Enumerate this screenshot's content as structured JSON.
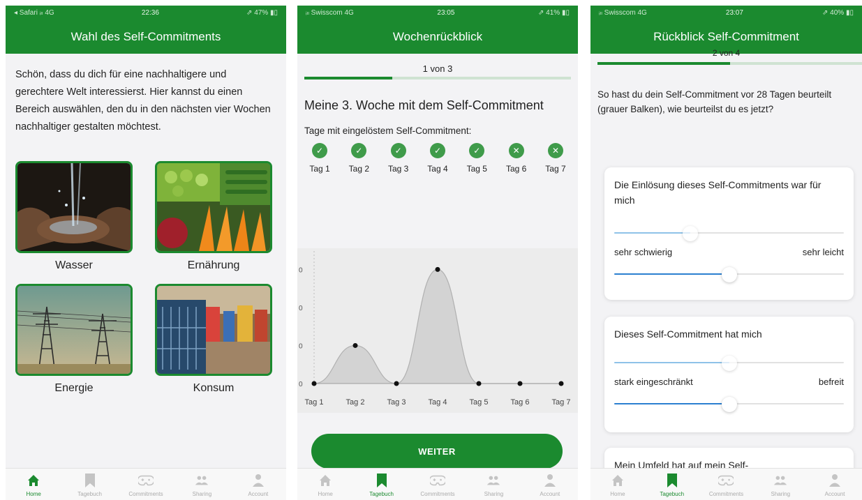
{
  "tabbar": {
    "items": [
      {
        "label": "Home",
        "icon": "home-icon"
      },
      {
        "label": "Tagebuch",
        "icon": "bookmark-icon"
      },
      {
        "label": "Commitments",
        "icon": "gamepad-icon"
      },
      {
        "label": "Sharing",
        "icon": "people-icon"
      },
      {
        "label": "Account",
        "icon": "person-icon"
      }
    ],
    "active_color": "#1b8a2f",
    "inactive_color": "#c4c4c4"
  },
  "phone1": {
    "status": {
      "carrier": "◂ Safari ᵢₗₗ 4G",
      "time": "22:36",
      "battery": "⇗ 47% ▮▯"
    },
    "title": "Wahl des Self-Commitments",
    "intro": "Schön, dass du dich für eine nachhaltigere und gerechtere Welt interessierst. Hier kannst du einen Bereich auswählen, den du in den nächsten vier Wochen nachhaltiger gestalten möchtest.",
    "categories": [
      {
        "label": "Wasser"
      },
      {
        "label": "Ernährung"
      },
      {
        "label": "Energie"
      },
      {
        "label": "Konsum"
      }
    ],
    "active_tab": 0
  },
  "phone2": {
    "status": {
      "carrier": "ᵢₗₗ Swisscom 4G",
      "time": "23:05",
      "battery": "⇗ 41% ▮▯"
    },
    "title": "Wochenrückblick",
    "progress_label": "1 von 3",
    "progress_fraction": 0.33,
    "week_title": "Meine 3. Woche mit dem Self-Commitment",
    "days_label": "Tage mit eingelöstem Self-Commitment:",
    "days": [
      {
        "label": "Tag 1",
        "done": true
      },
      {
        "label": "Tag 2",
        "done": true
      },
      {
        "label": "Tag 3",
        "done": true
      },
      {
        "label": "Tag 4",
        "done": true
      },
      {
        "label": "Tag 5",
        "done": true
      },
      {
        "label": "Tag 6",
        "done": false
      },
      {
        "label": "Tag 7",
        "done": false
      }
    ],
    "button_label": "WEITER",
    "active_tab": 1
  },
  "chart_data": {
    "type": "area",
    "categories": [
      "Tag 1",
      "Tag 2",
      "Tag 3",
      "Tag 4",
      "Tag 5",
      "Tag 6",
      "Tag 7"
    ],
    "values": [
      0,
      10,
      0,
      30,
      0,
      0,
      0
    ],
    "y_ticks": [
      0,
      10,
      20,
      30
    ],
    "y_tick_labels": [
      "0",
      "0",
      "0",
      "0"
    ],
    "ylim": [
      0,
      33
    ],
    "fill_color": "#d3d3d3",
    "line_color": "#b0b0b0",
    "point_color": "#111111"
  },
  "phone3": {
    "status": {
      "carrier": "ᵢₗₗ Swisscom 4G",
      "time": "23:07",
      "battery": "⇗ 40% ▮▯"
    },
    "title": "Rückblick Self-Commitment",
    "progress_label": "2 von 4",
    "progress_fraction": 0.5,
    "intro": "So hast du dein Self-Commitment vor 28 Tagen beurteilt (grauer Balken), wie beurteilst du es jetzt?",
    "cards": [
      {
        "question": "Die Einlösung dieses Self-Commitments war für mich",
        "min_label": "sehr schwierig",
        "max_label": "sehr leicht",
        "previous": 0.33,
        "current": 0.5
      },
      {
        "question": "Dieses Self-Commitment hat mich",
        "min_label": "stark eingeschränkt",
        "max_label": "befreit",
        "previous": 0.5,
        "current": 0.5
      },
      {
        "question": "Mein Umfeld hat auf mein Self-",
        "min_label": "",
        "max_label": "",
        "previous": null,
        "current": null
      }
    ],
    "active_tab": 1
  }
}
